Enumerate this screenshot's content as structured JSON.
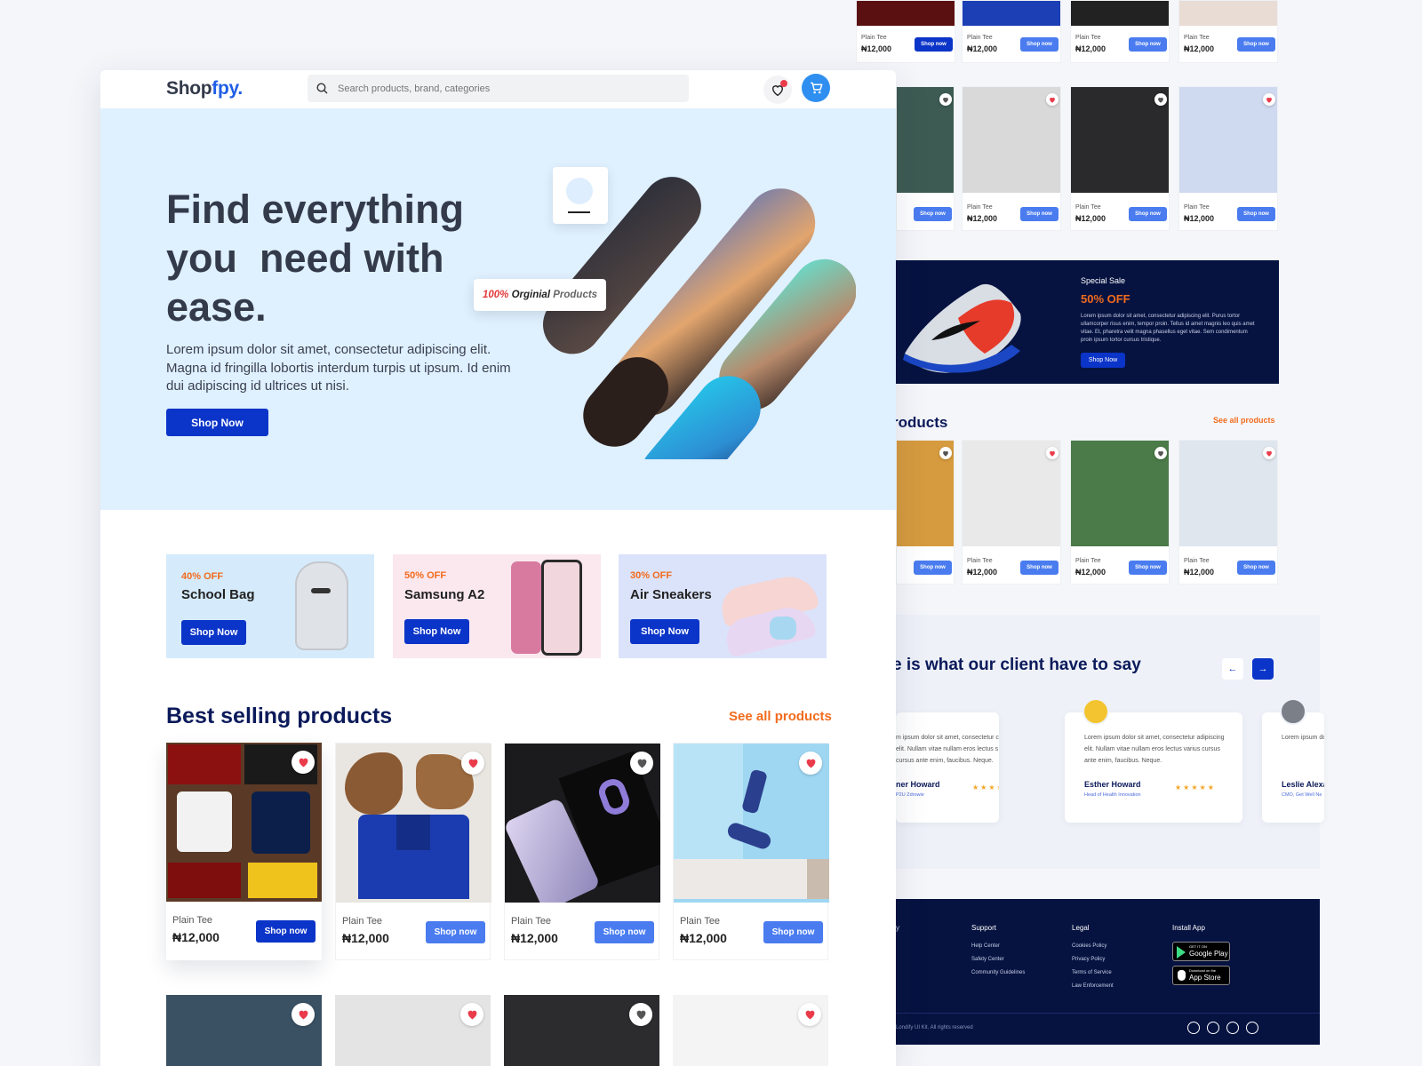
{
  "colors": {
    "primary": "#0b34c8",
    "accent": "#f26b1d",
    "navy": "#061341",
    "hero_bg": "#dff0fe",
    "heart_red": "#ea3b4b"
  },
  "header": {
    "logo_main": "Shop",
    "logo_accent": "fpy.",
    "search_placeholder": "Search products, brand, categories",
    "wishlist_icon": "heart-icon",
    "cart_icon": "cart-icon"
  },
  "hero": {
    "title_line1": "Find everything",
    "title_line2": "you  need with",
    "title_line3": "ease.",
    "description": "Lorem ipsum dolor sit amet, consectetur adipiscing elit. Magna id fringilla lobortis interdum turpis ut ipsum. Id enim dui adipiscing id ultrices ut nisi.",
    "cta": "Shop Now",
    "badge_pct": "100%",
    "badge_word": "Orginial",
    "badge_rest": "Products"
  },
  "promos": [
    {
      "discount": "40% OFF",
      "name": "School Bag",
      "cta": "Shop Now"
    },
    {
      "discount": "50% OFF",
      "name": "Samsung A2",
      "cta": "Shop Now"
    },
    {
      "discount": "30% OFF",
      "name": "Air Sneakers",
      "cta": "Shop Now"
    }
  ],
  "best_selling": {
    "heading": "Best selling products",
    "see_all": "See all products",
    "products": [
      {
        "name": "Plain Tee",
        "price": "₦12,000",
        "cta": "Shop now",
        "liked": true
      },
      {
        "name": "Plain Tee",
        "price": "₦12,000",
        "cta": "Shop now",
        "liked": true
      },
      {
        "name": "Plain Tee",
        "price": "₦12,000",
        "cta": "Shop now",
        "liked": false
      },
      {
        "name": "Plain Tee",
        "price": "₦12,000",
        "cta": "Shop now",
        "liked": true
      }
    ]
  },
  "right_panel": {
    "row1": [
      {
        "name": "Plain Tee",
        "price": "₦12,000",
        "cta": "Shop now"
      },
      {
        "name": "Plain Tee",
        "price": "₦12,000",
        "cta": "Shop now"
      },
      {
        "name": "Plain Tee",
        "price": "₦12,000",
        "cta": "Shop now"
      },
      {
        "name": "Plain Tee",
        "price": "₦12,000",
        "cta": "Shop now"
      }
    ],
    "row2": [
      {
        "name": "",
        "price": "",
        "cta": "Shop now"
      },
      {
        "name": "Plain Tee",
        "price": "₦12,000",
        "cta": "Shop now"
      },
      {
        "name": "Plain Tee",
        "price": "₦12,000",
        "cta": "Shop now"
      },
      {
        "name": "Plain Tee",
        "price": "₦12,000",
        "cta": "Shop now"
      }
    ],
    "sale": {
      "label": "Special Sale",
      "discount": "50% OFF",
      "text": "Lorem ipsum dolor sit amet, consectetur adipiscing elit. Purus tortor ullamcorper risus enim, tempor proin. Tellus id amet magnis leo quis amet vitae. Et, pharetra velit magna phasellus eget vitae. Sem condimentum proin ipsum tortor cursus tristique.",
      "cta": "Shop Now"
    },
    "section_heading": "roducts",
    "see_all": "See all products",
    "row3": [
      {
        "name": "",
        "price": "",
        "cta": "Shop now"
      },
      {
        "name": "Plain Tee",
        "price": "₦12,000",
        "cta": "Shop now"
      },
      {
        "name": "Plain Tee",
        "price": "₦12,000",
        "cta": "Shop now"
      },
      {
        "name": "Plain Tee",
        "price": "₦12,000",
        "cta": "Shop now"
      }
    ],
    "testimonials": {
      "heading": "e is what our client have to say",
      "cards": [
        {
          "text": "m ipsum dolor sit amet, consectetur cing elit. Nullam vitae nullam eros lectus s cursus ante enim, faucibus. Neque.",
          "name": "ner Howard",
          "role": "P2U Zdrowie",
          "stars": "★★★★★"
        },
        {
          "text": "Lorem ipsum dolor sit amet, consectetur adipiscing elit. Nullam vitae nullam eros lectus varius cursus ante enim, faucibus. Neque.",
          "name": "Esther Howard",
          "role": "Head of Health Innovation",
          "stars": "★★★★★"
        },
        {
          "text": "Lorem ipsum dol adipiscing elit. N varius cursus ant",
          "name": "Leslie Alexa",
          "role": "CMO, Get Well Ne",
          "stars": ""
        }
      ]
    },
    "footer": {
      "frag": "y",
      "support": {
        "title": "Support",
        "links": [
          "Help Center",
          "Safety Center",
          "Community Guidelines"
        ]
      },
      "legal": {
        "title": "Legal",
        "links": [
          "Cookies Policy",
          "Privacy Policy",
          "Terms of Service",
          "Law Enforcement"
        ]
      },
      "install": {
        "title": "Install App",
        "google_small": "GET IT ON",
        "google": "Google Play",
        "apple_small": "Download on the",
        "apple": "App Store"
      },
      "copyright": "Londify UI Kit. All rights reserved",
      "socials": [
        "instagram-icon",
        "dribbble-icon",
        "twitter-icon",
        "youtube-icon"
      ]
    }
  }
}
